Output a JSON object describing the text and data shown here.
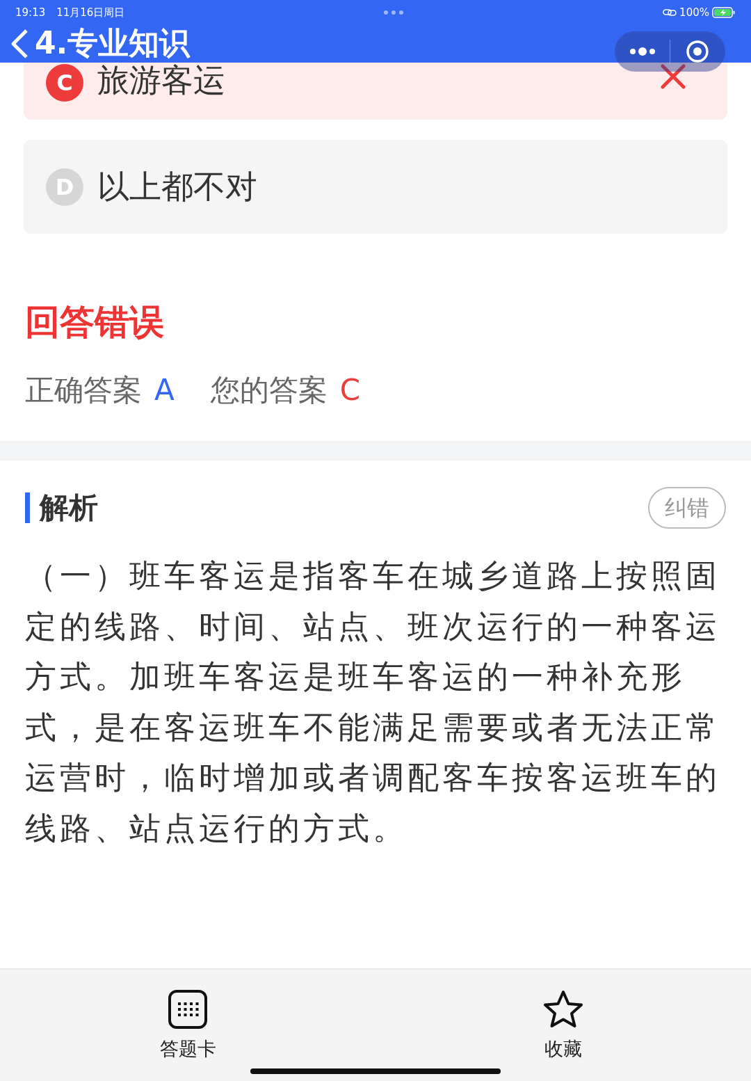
{
  "status_bar": {
    "time": "19:13",
    "date": "11月16日周日",
    "battery": "100%"
  },
  "header": {
    "title": "4.专业知识"
  },
  "options": [
    {
      "letter": "C",
      "text": "旅游客运",
      "kind": "wrong"
    },
    {
      "letter": "D",
      "text": "以上都不对",
      "kind": "plain"
    }
  ],
  "result": {
    "title": "回答错误",
    "correct_label": "正确答案",
    "correct": "A",
    "yours_label": "您的答案",
    "yours": "C"
  },
  "analysis": {
    "title": "解析",
    "report_button": "纠错",
    "text": "（一）班车客运是指客车在城乡道路上按照固定的线路、时间、站点、班次运行的一种客运方式。加班车客运是班车客运的一种补充形式，是在客运班车不能满足需要或者无法正常运营时，临时增加或者调配客车按客运班车的线路、站点运行的方式。"
  },
  "bottom_bar": [
    {
      "label": "答题卡",
      "kind": "grid"
    },
    {
      "label": "收藏",
      "kind": "star"
    }
  ]
}
